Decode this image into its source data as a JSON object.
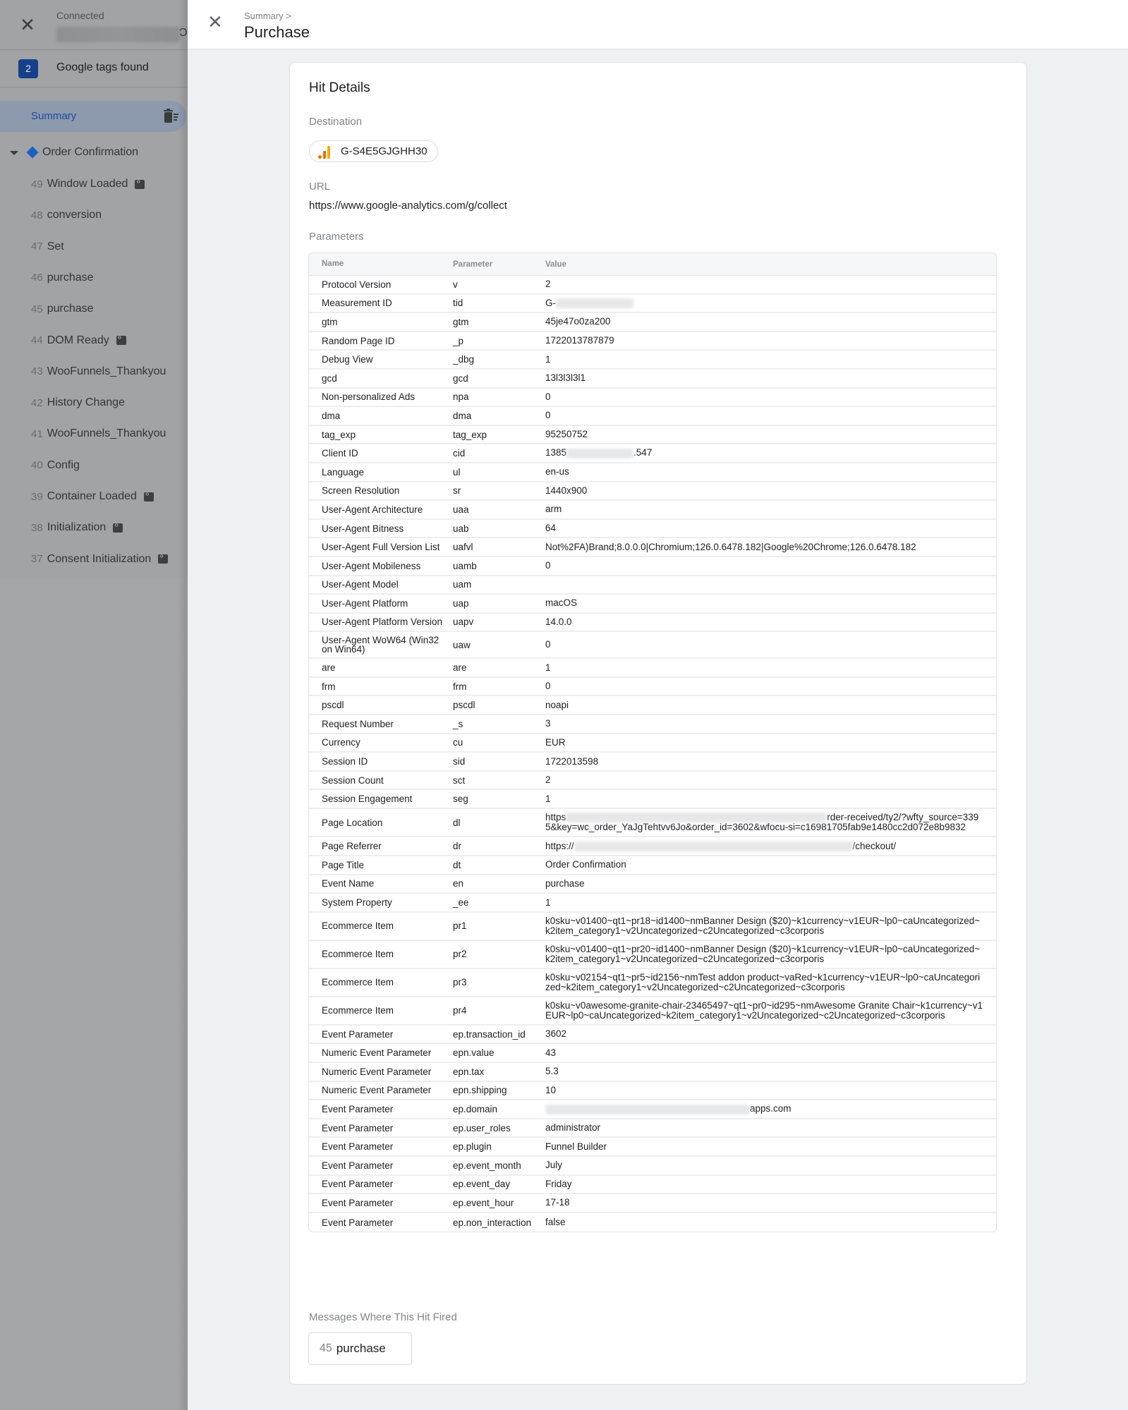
{
  "sidebar": {
    "status": "Connected",
    "tags_count": "2",
    "tags_label": "Google tags found",
    "summary_label": "Summary",
    "group_label": "Order Confirmation",
    "items": [
      {
        "num": "49",
        "label": "Window Loaded",
        "has_icon": true
      },
      {
        "num": "48",
        "label": "conversion",
        "has_icon": false
      },
      {
        "num": "47",
        "label": "Set",
        "has_icon": false
      },
      {
        "num": "46",
        "label": "purchase",
        "has_icon": false
      },
      {
        "num": "45",
        "label": "purchase",
        "has_icon": false
      },
      {
        "num": "44",
        "label": "DOM Ready",
        "has_icon": true
      },
      {
        "num": "43",
        "label": "WooFunnels_Thankyou",
        "has_icon": false
      },
      {
        "num": "42",
        "label": "History Change",
        "has_icon": false
      },
      {
        "num": "41",
        "label": "WooFunnels_Thankyou",
        "has_icon": false
      },
      {
        "num": "40",
        "label": "Config",
        "has_icon": false
      },
      {
        "num": "39",
        "label": "Container Loaded",
        "has_icon": true
      },
      {
        "num": "38",
        "label": "Initialization",
        "has_icon": true
      },
      {
        "num": "37",
        "label": "Consent Initialization",
        "has_icon": true
      }
    ]
  },
  "header": {
    "breadcrumb": "Summary >",
    "title": "Purchase"
  },
  "hit_details": {
    "title": "Hit Details",
    "destination_label": "Destination",
    "destination_id": "G-S4E5GJGHH30",
    "url_label": "URL",
    "url": "https://www.google-analytics.com/g/collect",
    "parameters_label": "Parameters",
    "columns": [
      "Name",
      "Parameter",
      "Value"
    ],
    "rows": [
      {
        "name": "Protocol Version",
        "param": "v",
        "value": "2"
      },
      {
        "name": "Measurement ID",
        "param": "tid",
        "value": "G-",
        "redacted": true
      },
      {
        "name": "gtm",
        "param": "gtm",
        "value": "45je47o0za200"
      },
      {
        "name": "Random Page ID",
        "param": "_p",
        "value": "1722013787879"
      },
      {
        "name": "Debug View",
        "param": "_dbg",
        "value": "1"
      },
      {
        "name": "gcd",
        "param": "gcd",
        "value": "13l3l3l3l1"
      },
      {
        "name": "Non-personalized Ads",
        "param": "npa",
        "value": "0"
      },
      {
        "name": "dma",
        "param": "dma",
        "value": "0"
      },
      {
        "name": "tag_exp",
        "param": "tag_exp",
        "value": "95250752"
      },
      {
        "name": "Client ID",
        "param": "cid",
        "value": "1385",
        "redacted": true,
        "suffix": ".547"
      },
      {
        "name": "Language",
        "param": "ul",
        "value": "en-us"
      },
      {
        "name": "Screen Resolution",
        "param": "sr",
        "value": "1440x900"
      },
      {
        "name": "User-Agent Architecture",
        "param": "uaa",
        "value": "arm"
      },
      {
        "name": "User-Agent Bitness",
        "param": "uab",
        "value": "64"
      },
      {
        "name": "User-Agent Full Version List",
        "param": "uafvl",
        "value": "Not%2FA)Brand;8.0.0.0|Chromium;126.0.6478.182|Google%20Chrome;126.0.6478.182"
      },
      {
        "name": "User-Agent Mobileness",
        "param": "uamb",
        "value": "0"
      },
      {
        "name": "User-Agent Model",
        "param": "uam",
        "value": ""
      },
      {
        "name": "User-Agent Platform",
        "param": "uap",
        "value": "macOS"
      },
      {
        "name": "User-Agent Platform Version",
        "param": "uapv",
        "value": "14.0.0"
      },
      {
        "name": "User-Agent WoW64 (Win32 on Win64)",
        "param": "uaw",
        "value": "0",
        "multi": true
      },
      {
        "name": "are",
        "param": "are",
        "value": "1"
      },
      {
        "name": "frm",
        "param": "frm",
        "value": "0"
      },
      {
        "name": "pscdl",
        "param": "pscdl",
        "value": "noapi"
      },
      {
        "name": "Request Number",
        "param": "_s",
        "value": "3"
      },
      {
        "name": "Currency",
        "param": "cu",
        "value": "EUR"
      },
      {
        "name": "Session ID",
        "param": "sid",
        "value": "1722013598"
      },
      {
        "name": "Session Count",
        "param": "sct",
        "value": "2"
      },
      {
        "name": "Session Engagement",
        "param": "seg",
        "value": "1"
      },
      {
        "name": "Page Location",
        "param": "dl",
        "value": "https",
        "redacted": true,
        "suffix": "rder-received/ty2/?wfty_source=3395&key=wc_order_YaJgTehtvv6Jo&order_id=3602&wfocu-si=c16981705fab9e1480cc2d072e8b9832",
        "multi": true
      },
      {
        "name": "Page Referrer",
        "param": "dr",
        "value": "https://",
        "redacted": true,
        "suffix": "/checkout/"
      },
      {
        "name": "Page Title",
        "param": "dt",
        "value": "Order Confirmation"
      },
      {
        "name": "Event Name",
        "param": "en",
        "value": "purchase"
      },
      {
        "name": "System Property",
        "param": "_ee",
        "value": "1"
      },
      {
        "name": "Ecommerce Item",
        "param": "pr1",
        "value": "k0sku~v01400~qt1~pr18~id1400~nmBanner Design ($20)~k1currency~v1EUR~lp0~caUncategorized~k2item_category1~v2Uncategorized~c2Uncategorized~c3corporis",
        "multi": true
      },
      {
        "name": "Ecommerce Item",
        "param": "pr2",
        "value": "k0sku~v01400~qt1~pr20~id1400~nmBanner Design ($20)~k1currency~v1EUR~lp0~caUncategorized~k2item_category1~v2Uncategorized~c2Uncategorized~c3corporis",
        "multi": true
      },
      {
        "name": "Ecommerce Item",
        "param": "pr3",
        "value": "k0sku~v02154~qt1~pr5~id2156~nmTest addon product~vaRed~k1currency~v1EUR~lp0~caUncategorized~k2item_category1~v2Uncategorized~c2Uncategorized~c3corporis",
        "multi": true
      },
      {
        "name": "Ecommerce Item",
        "param": "pr4",
        "value": "k0sku~v0awesome-granite-chair-23465497~qt1~pr0~id295~nmAwesome Granite Chair~k1currency~v1EUR~lp0~caUncategorized~k2item_category1~v2Uncategorized~c2Uncategorized~c3corporis",
        "multi": true
      },
      {
        "name": "Event Parameter",
        "param": "ep.transaction_id",
        "value": "3602"
      },
      {
        "name": "Numeric Event Parameter",
        "param": "epn.value",
        "value": "43"
      },
      {
        "name": "Numeric Event Parameter",
        "param": "epn.tax",
        "value": "5.3"
      },
      {
        "name": "Numeric Event Parameter",
        "param": "epn.shipping",
        "value": "10"
      },
      {
        "name": "Event Parameter",
        "param": "ep.domain",
        "value": "",
        "redacted": true,
        "suffix": "apps.com"
      },
      {
        "name": "Event Parameter",
        "param": "ep.user_roles",
        "value": "administrator"
      },
      {
        "name": "Event Parameter",
        "param": "ep.plugin",
        "value": "Funnel Builder"
      },
      {
        "name": "Event Parameter",
        "param": "ep.event_month",
        "value": "July"
      },
      {
        "name": "Event Parameter",
        "param": "ep.event_day",
        "value": "Friday"
      },
      {
        "name": "Event Parameter",
        "param": "ep.event_hour",
        "value": "17-18"
      },
      {
        "name": "Event Parameter",
        "param": "ep.non_interaction",
        "value": "false"
      }
    ],
    "messages_label": "Messages Where This Hit Fired",
    "message": {
      "num": "45",
      "label": "purchase"
    }
  },
  "colors": {
    "badge": "#17408a",
    "summary_text": "#1d4a98",
    "ga_orange": "#e8710a",
    "ga_yellow": "#f9ab00"
  }
}
